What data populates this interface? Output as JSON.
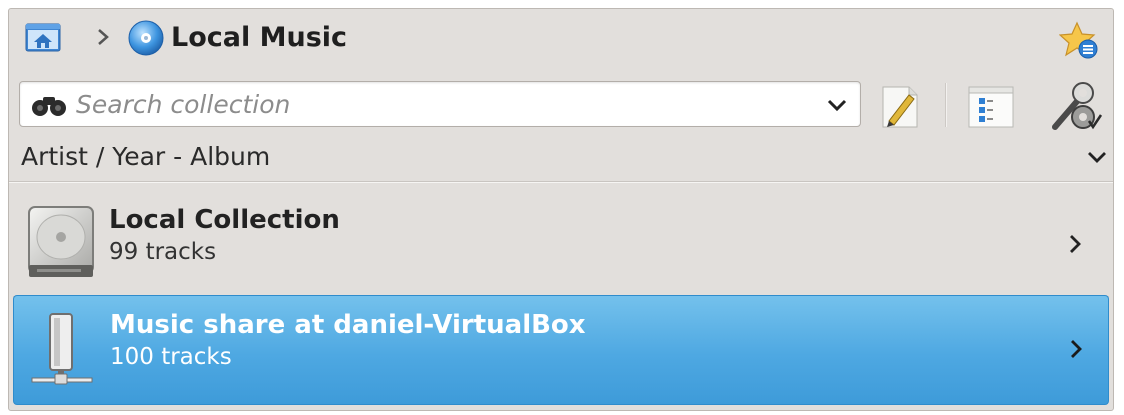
{
  "breadcrumb": {
    "home_icon": "home-folder-icon",
    "separator": ">",
    "current_icon": "cd-disc-icon",
    "title": "Local Music",
    "bookmark_icon": "bookmark-star-icon"
  },
  "search": {
    "placeholder": "Search collection",
    "value": "",
    "icon": "binoculars-icon"
  },
  "toolbar": {
    "edit_icon": "edit-filter-icon",
    "tree_icon": "tree-view-icon",
    "tools_icon": "tools-icon"
  },
  "sort": {
    "label": "Artist / Year - Album"
  },
  "collections": [
    {
      "name": "Local Collection",
      "tracks": "99 tracks",
      "icon": "hard-drive-icon",
      "selected": false
    },
    {
      "name": "Music share at daniel-VirtualBox",
      "tracks": "100 tracks",
      "icon": "network-server-icon",
      "selected": true
    }
  ],
  "colors": {
    "panel_bg": "#e2dfdc",
    "selection": "#4ea8e2",
    "selection_text": "#ffffff"
  }
}
